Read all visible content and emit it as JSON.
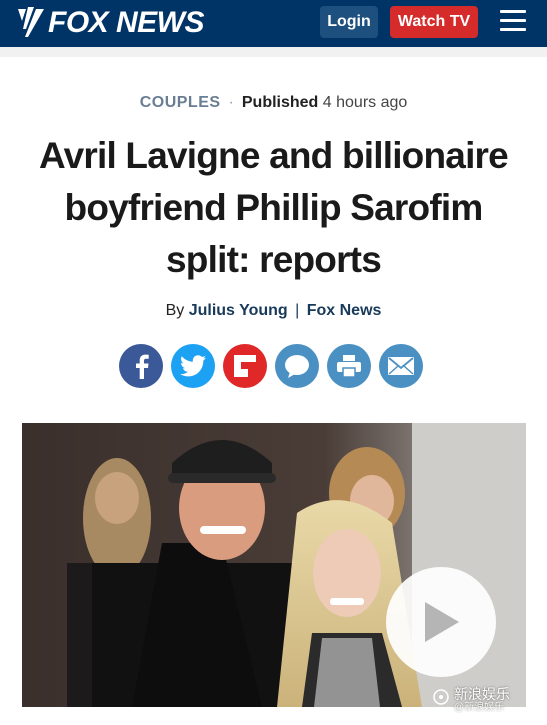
{
  "header": {
    "logo_text": "FOX NEWS",
    "login_label": "Login",
    "watch_label": "Watch TV",
    "brand_color": "#003366",
    "watch_color": "#d52b2b"
  },
  "meta": {
    "category": "COUPLES",
    "published_label": "Published",
    "published_time": "4 hours ago"
  },
  "article": {
    "headline_line1": "Avril Lavigne and billionaire",
    "headline_line2": "boyfriend Phillip Sarofim",
    "headline_line3": "split: reports",
    "byline_prefix": "By",
    "author": "Julius Young",
    "separator": "|",
    "outlet": "Fox News"
  },
  "share": [
    {
      "name": "facebook-icon",
      "color": "#3b5998",
      "glyph": "f"
    },
    {
      "name": "twitter-icon",
      "color": "#1da1f2",
      "glyph": "t"
    },
    {
      "name": "flipboard-icon",
      "color": "#e12828",
      "glyph": "F"
    },
    {
      "name": "comment-icon",
      "color": "#4a90c2",
      "glyph": "c"
    },
    {
      "name": "print-icon",
      "color": "#4a90c2",
      "glyph": "p"
    },
    {
      "name": "email-icon",
      "color": "#4a90c2",
      "glyph": "e"
    }
  ],
  "media": {
    "play_icon": "play-icon"
  },
  "watermark": {
    "main": "新浪娱乐",
    "sub": "@新浪娱乐"
  }
}
